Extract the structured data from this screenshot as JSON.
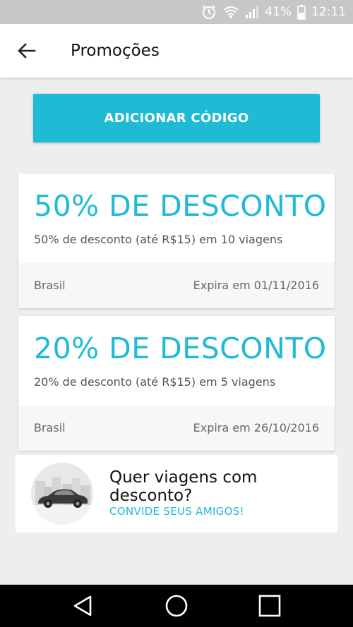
{
  "status_bar": {
    "battery_percent": "41%",
    "time": "12:11",
    "icons": [
      "alarm-icon",
      "wifi-icon",
      "signal-icon",
      "battery-icon"
    ]
  },
  "app_bar": {
    "title": "Promoções",
    "back_icon": "arrow-left-icon"
  },
  "add_code_button": {
    "label": "ADICIONAR CÓDIGO"
  },
  "promotions": [
    {
      "amount": "50% DE DESCONTO",
      "description": "50% de desconto (até R$15) em 10 viagens",
      "region": "Brasil",
      "expiry": "Expira em 01/11/2016"
    },
    {
      "amount": "20% DE DESCONTO",
      "description": "20% de desconto (até R$15) em 5 viagens",
      "region": "Brasil",
      "expiry": "Expira em 26/10/2016"
    }
  ],
  "invite": {
    "line1": "Quer viagens com",
    "line2": "desconto?",
    "cta": "CONVIDE SEUS AMIGOS!",
    "illustration": "car-city-illustration"
  },
  "nav_bar": {
    "icons": [
      "back-triangle-icon",
      "home-circle-icon",
      "recents-square-icon"
    ]
  },
  "colors": {
    "accent": "#1fbad6",
    "status_bar": "#c7c7c7",
    "background": "#eeeeee",
    "nav_bar": "#000000"
  }
}
